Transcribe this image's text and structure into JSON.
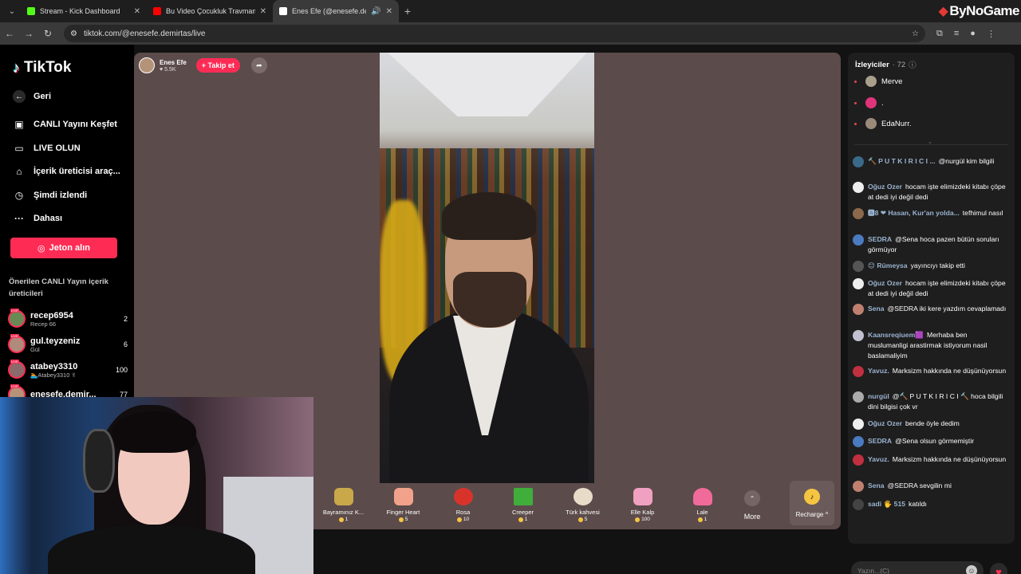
{
  "browser": {
    "tabs": [
      {
        "label": "Stream - Kick Dashboard",
        "fav_color": "#53fc18",
        "active": false
      },
      {
        "label": "Bu Video Çocukluk Travmamd",
        "fav_color": "#ff0000",
        "active": false
      },
      {
        "label": "Enes Efe (@enesefe.demirta",
        "fav_color": "#ffffff",
        "active": true
      }
    ],
    "url": "tiktok.com/@enesefe.demirtas/live",
    "brand_logo": "ByNoGame"
  },
  "sidebar": {
    "logo": "TikTok",
    "nav": [
      {
        "label": "Geri",
        "icon": "back-arrow-icon"
      },
      {
        "label": "CANLI Yayını Keşfet",
        "icon": "live-tv-icon"
      },
      {
        "label": "LIVE OLUN",
        "icon": "camera-icon"
      },
      {
        "label": "İçerik üreticisi araç...",
        "icon": "creator-tools-icon"
      },
      {
        "label": "Şimdi izlendi",
        "icon": "history-icon"
      },
      {
        "label": "Dahası",
        "icon": "more-dots-icon"
      }
    ],
    "jeton_button": "Jeton alın",
    "recommended_title": "Önerilen CANLI Yayın içerik üreticileri",
    "recommended": [
      {
        "name": "recep6954",
        "sub": "Recep 66",
        "count": "2",
        "color": "#6a8a55"
      },
      {
        "name": "gul.teyzeniz",
        "sub": "Gül",
        "count": "6",
        "color": "#b08a7a"
      },
      {
        "name": "atabey3310",
        "sub": "🏊Atabey3310 ✌",
        "count": "100",
        "color": "#8a6a6a"
      },
      {
        "name": "enesefe.demir...",
        "sub": "",
        "count": "77",
        "color": "#b59378"
      }
    ]
  },
  "stage": {
    "host_name": "Enes Efe",
    "host_likes": "♥ 5.5K",
    "follow_label": "+ Takip et",
    "gifts": [
      {
        "name": "Bayramınız K...",
        "price": "1",
        "color": "#c9a84a"
      },
      {
        "name": "Finger Heart",
        "price": "5",
        "color": "#f2a28a"
      },
      {
        "name": "Rosa",
        "price": "10",
        "color": "#d8332b"
      },
      {
        "name": "Creeper",
        "price": "1",
        "color": "#3fae3a"
      },
      {
        "name": "Türk kahvesi",
        "price": "5",
        "color": "#e8dcc8"
      },
      {
        "name": "Elle Kalp",
        "price": "100",
        "color": "#f0a0c0"
      },
      {
        "name": "Lale",
        "price": "1",
        "color": "#f06a9a"
      }
    ],
    "more_label": "More",
    "recharge_label": "Recharge ^"
  },
  "viewers": {
    "title": "İzleyiciler",
    "count": "· 72",
    "list": [
      {
        "name": "Merve",
        "color": "#a8a08a"
      },
      {
        "name": ".",
        "color": "#e0347a"
      },
      {
        "name": "EdaNurr.",
        "color": "#9a8a7a"
      }
    ]
  },
  "chat": [
    {
      "user": "🔨 P U T K I R I C I ...",
      "text": "@nurgül kim bilgili",
      "color": "#3a6a8a"
    },
    {
      "user": "Oğuz Ozer",
      "text": "hocam işte elimizdeki kitabı çöpe at dedi iyi değil dedi",
      "color": "#eeeeee"
    },
    {
      "user": "🅰8 ❤ Hasan, Kur'an yolda...",
      "text": "tefhimul nasıl",
      "color": "#8a6a4a"
    },
    {
      "user": "SEDRA",
      "text": "@Sena hoca pazen bütün soruları görmüyor",
      "color": "#4a7ac0"
    },
    {
      "user": "😊 Rümeysa",
      "text": "yayıncıyı takip etti",
      "color": "#555555"
    },
    {
      "user": "Oğuz Ozer",
      "text": "hocam işte elimizdeki kitabı çöpe at dedi iyi değil dedi",
      "color": "#eeeeee"
    },
    {
      "user": "Sena",
      "text": "@SEDRA iki kere yazdım cevaplamadı",
      "color": "#c08070"
    },
    {
      "user": "Kaansreqiuem🟪",
      "text": "Merhaba ben muslumanligi arastirmak istiyorum nasil baslamaliyim",
      "color": "#c0c0d0"
    },
    {
      "user": "Yavuz.",
      "text": "Marksizm hakkında ne düşünüyorsun",
      "color": "#c03040"
    },
    {
      "user": "nurgül",
      "text": "@🔨 P U T K I R I C I 🔨 hoca bilgili dini bilgisi çok vr",
      "color": "#aaaaaa"
    },
    {
      "user": "Oğuz Ozer",
      "text": "bende öyle dedim",
      "color": "#eeeeee"
    },
    {
      "user": "SEDRA",
      "text": "@Sena olsun görmemiştir",
      "color": "#4a7ac0"
    },
    {
      "user": "Yavuz.",
      "text": "Marksizm hakkında ne düşünüyorsun",
      "color": "#c03040"
    },
    {
      "user": "Sena",
      "text": "@SEDRA sevgilin mi",
      "color": "#c08070"
    },
    {
      "user": "sadi 🖐 515",
      "text": "katıldı",
      "color": "#444444"
    }
  ],
  "chat_input": {
    "placeholder": "Yazın...(C)"
  }
}
